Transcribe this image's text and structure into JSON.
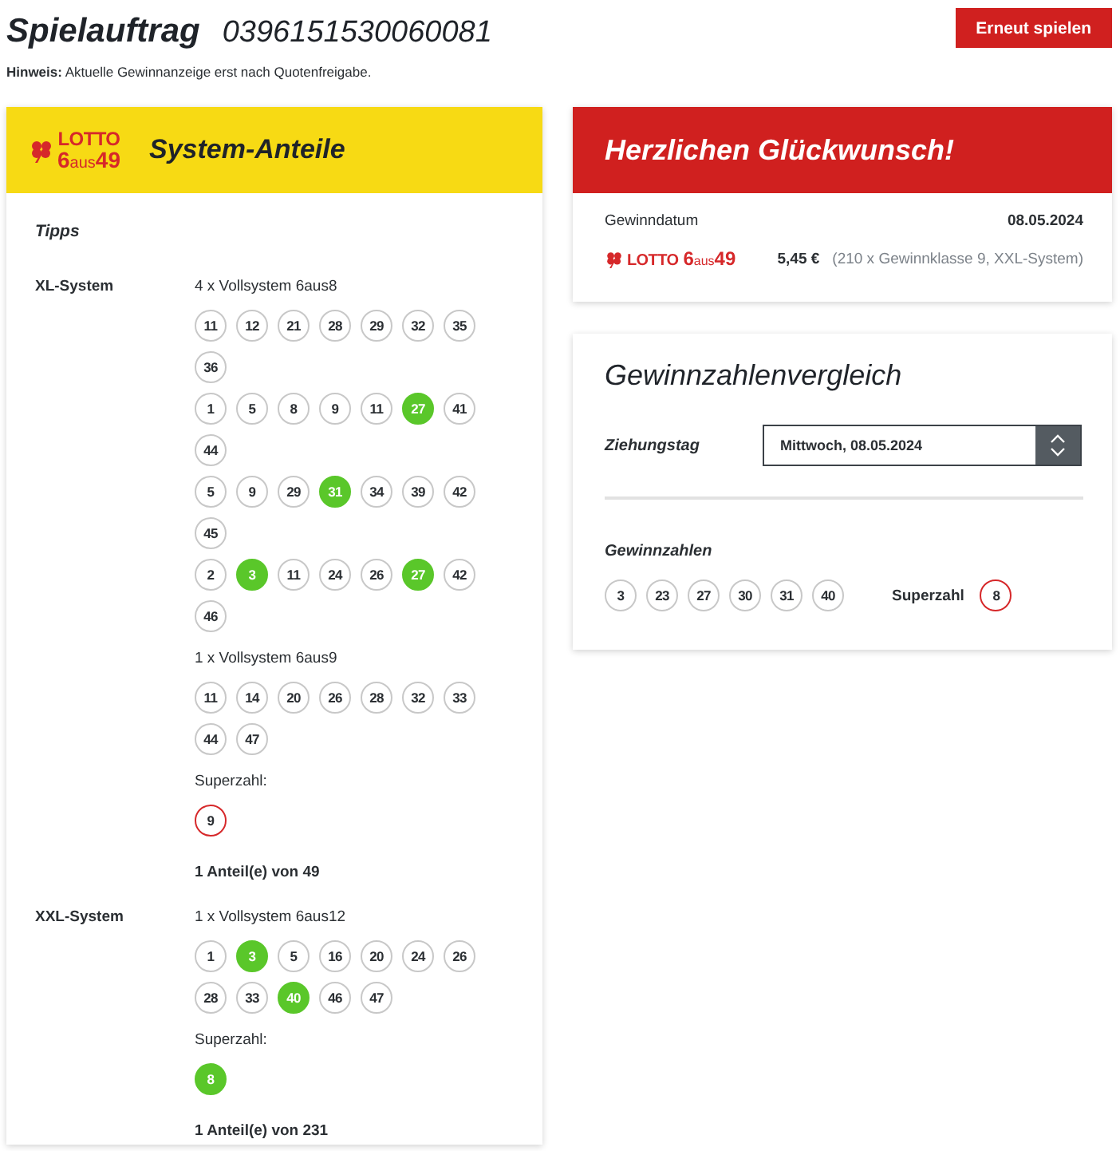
{
  "header": {
    "title": "Spielauftrag",
    "order_number": "0396151530060081",
    "button": "Erneut spielen"
  },
  "notice": {
    "label": "Hinweis:",
    "text": "Aktuelle Gewinnanzeige erst nach Quotenfreigabe."
  },
  "shares_card": {
    "logo": {
      "brand": "LOTTO",
      "game": [
        "6",
        "aus",
        "49"
      ]
    },
    "title": "System-Anteile",
    "section": "Tipps",
    "systems": [
      {
        "name": "XL-System",
        "groups": [
          {
            "label": "4 x Vollsystem 6aus8",
            "tips": [
              [
                {
                  "n": "11",
                  "hit": false
                },
                {
                  "n": "12",
                  "hit": false
                },
                {
                  "n": "21",
                  "hit": false
                },
                {
                  "n": "28",
                  "hit": false
                },
                {
                  "n": "29",
                  "hit": false
                },
                {
                  "n": "32",
                  "hit": false
                },
                {
                  "n": "35",
                  "hit": false
                },
                {
                  "n": "36",
                  "hit": false
                }
              ],
              [
                {
                  "n": "1",
                  "hit": false
                },
                {
                  "n": "5",
                  "hit": false
                },
                {
                  "n": "8",
                  "hit": false
                },
                {
                  "n": "9",
                  "hit": false
                },
                {
                  "n": "11",
                  "hit": false
                },
                {
                  "n": "27",
                  "hit": true
                },
                {
                  "n": "41",
                  "hit": false
                },
                {
                  "n": "44",
                  "hit": false
                }
              ],
              [
                {
                  "n": "5",
                  "hit": false
                },
                {
                  "n": "9",
                  "hit": false
                },
                {
                  "n": "29",
                  "hit": false
                },
                {
                  "n": "31",
                  "hit": true
                },
                {
                  "n": "34",
                  "hit": false
                },
                {
                  "n": "39",
                  "hit": false
                },
                {
                  "n": "42",
                  "hit": false
                },
                {
                  "n": "45",
                  "hit": false
                }
              ],
              [
                {
                  "n": "2",
                  "hit": false
                },
                {
                  "n": "3",
                  "hit": true
                },
                {
                  "n": "11",
                  "hit": false
                },
                {
                  "n": "24",
                  "hit": false
                },
                {
                  "n": "26",
                  "hit": false
                },
                {
                  "n": "27",
                  "hit": true
                },
                {
                  "n": "42",
                  "hit": false
                },
                {
                  "n": "46",
                  "hit": false
                }
              ]
            ]
          },
          {
            "label": "1 x Vollsystem 6aus9",
            "tips": [
              [
                {
                  "n": "11",
                  "hit": false
                },
                {
                  "n": "14",
                  "hit": false
                },
                {
                  "n": "20",
                  "hit": false
                },
                {
                  "n": "26",
                  "hit": false
                },
                {
                  "n": "28",
                  "hit": false
                },
                {
                  "n": "32",
                  "hit": false
                },
                {
                  "n": "33",
                  "hit": false
                },
                {
                  "n": "44",
                  "hit": false
                },
                {
                  "n": "47",
                  "hit": false
                }
              ]
            ]
          }
        ],
        "superzahl_label": "Superzahl:",
        "superzahl": {
          "n": "9",
          "hit": false
        },
        "shares": "1 Anteil(e) von 49"
      },
      {
        "name": "XXL-System",
        "groups": [
          {
            "label": "1 x Vollsystem 6aus12",
            "tips": [
              [
                {
                  "n": "1",
                  "hit": false
                },
                {
                  "n": "3",
                  "hit": true
                },
                {
                  "n": "5",
                  "hit": false
                },
                {
                  "n": "16",
                  "hit": false
                },
                {
                  "n": "20",
                  "hit": false
                },
                {
                  "n": "24",
                  "hit": false
                },
                {
                  "n": "26",
                  "hit": false
                },
                {
                  "n": "28",
                  "hit": false
                },
                {
                  "n": "33",
                  "hit": false
                },
                {
                  "n": "40",
                  "hit": true
                },
                {
                  "n": "46",
                  "hit": false
                },
                {
                  "n": "47",
                  "hit": false
                }
              ]
            ]
          }
        ],
        "superzahl_label": "Superzahl:",
        "superzahl": {
          "n": "8",
          "hit": true
        },
        "shares": "1 Anteil(e) von 231"
      }
    ]
  },
  "win_card": {
    "title": "Herzlichen Glückwunsch!",
    "date_label": "Gewinndatum",
    "date": "08.05.2024",
    "logo": {
      "brand": "LOTTO",
      "game": [
        "6",
        "aus",
        "49"
      ]
    },
    "amount": "5,45 €",
    "detail": "(210 x Gewinnklasse 9, XXL-System)"
  },
  "compare_card": {
    "title": "Gewinnzahlenvergleich",
    "draw_label": "Ziehungstag",
    "draw_select": {
      "value": "Mittwoch, 08.05.2024"
    },
    "numbers_label": "Gewinnzahlen",
    "numbers": [
      "3",
      "23",
      "27",
      "30",
      "31",
      "40"
    ],
    "superzahl_label": "Superzahl",
    "superzahl": "8"
  }
}
